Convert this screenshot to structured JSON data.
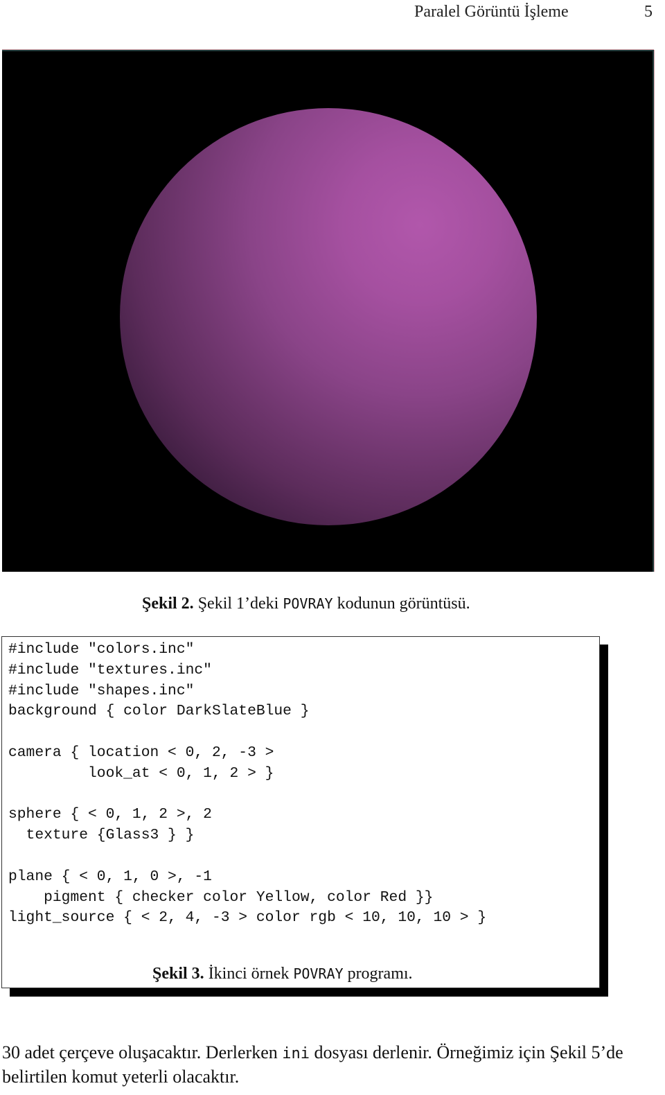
{
  "header": {
    "running_title": "Paralel Görüntü İşleme",
    "page_number": "5"
  },
  "figure2": {
    "image_description": "POV-Ray render of a pink/purple shaded sphere on a black background",
    "colors": {
      "background": "#000000",
      "sphere_highlight": "#b157ab",
      "sphere_mid": "#8a4488",
      "sphere_shadow": "#2c1530"
    },
    "caption": {
      "label": "Şekil 2.",
      "text_before": "Şekil 1’deki",
      "code_word": "POVRAY",
      "text_after": "kodunun görüntüsü."
    }
  },
  "figure3": {
    "code_lines": [
      "#include \"colors.inc\"",
      "#include \"textures.inc\"",
      "#include \"shapes.inc\"",
      "background { color DarkSlateBlue }",
      "",
      "camera { location < 0, 2, -3 >",
      "         look_at < 0, 1, 2 > }",
      "",
      "sphere { < 0, 1, 2 >, 2",
      "  texture {Glass3 } }",
      "",
      "plane { < 0, 1, 0 >, -1",
      "    pigment { checker color Yellow, color Red }}",
      "light_source { < 2, 4, -3 > color rgb < 10, 10, 10 > }"
    ],
    "caption": {
      "label": "Şekil 3.",
      "text_before": "İkinci örnek",
      "code_word": "POVRAY",
      "text_after": "programı."
    }
  },
  "paragraph": {
    "part1": "30 adet çerçeve oluşacaktır. Derlerken",
    "code_word": "ini",
    "part2": "dosyası derlenir. Örneğimiz için Şekil 5’de belirtilen komut yeterli olacaktır."
  }
}
